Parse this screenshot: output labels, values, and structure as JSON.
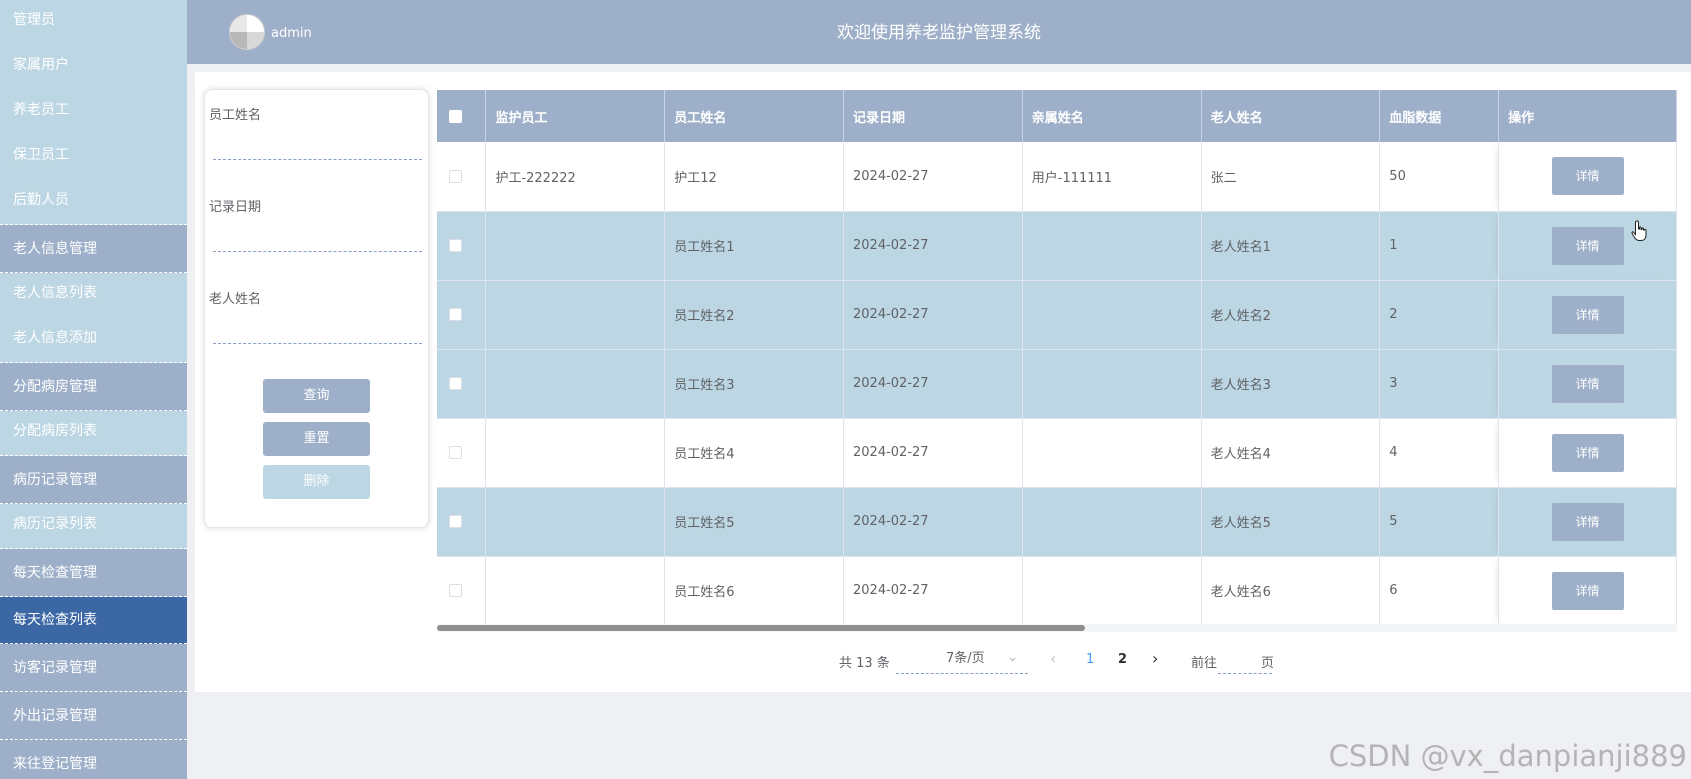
{
  "sidebar": {
    "items": [
      {
        "label": "管理员",
        "type": "sub"
      },
      {
        "label": "家属用户",
        "type": "sub"
      },
      {
        "label": "养老员工",
        "type": "sub"
      },
      {
        "label": "保卫员工",
        "type": "sub"
      },
      {
        "label": "后勤人员",
        "type": "sub"
      },
      {
        "label": "老人信息管理",
        "type": "group"
      },
      {
        "label": "老人信息列表",
        "type": "sub"
      },
      {
        "label": "老人信息添加",
        "type": "sub"
      },
      {
        "label": "分配病房管理",
        "type": "group"
      },
      {
        "label": "分配病房列表",
        "type": "sub"
      },
      {
        "label": "病历记录管理",
        "type": "group"
      },
      {
        "label": "病历记录列表",
        "type": "sub"
      },
      {
        "label": "每天检查管理",
        "type": "group"
      },
      {
        "label": "每天检查列表",
        "type": "active"
      },
      {
        "label": "访客记录管理",
        "type": "group"
      },
      {
        "label": "外出记录管理",
        "type": "group"
      },
      {
        "label": "来往登记管理",
        "type": "group"
      }
    ]
  },
  "header": {
    "user": "admin",
    "title": "欢迎使用养老监护管理系统"
  },
  "search": {
    "staff_name_label": "员工姓名",
    "record_date_label": "记录日期",
    "elder_name_label": "老人姓名",
    "query_button": "查询",
    "reset_button": "重置",
    "delete_button": "删除"
  },
  "table": {
    "columns": [
      "监护员工",
      "员工姓名",
      "记录日期",
      "亲属姓名",
      "老人姓名",
      "血脂数据",
      "操作"
    ],
    "rows": [
      {
        "guardian": "护工-222222",
        "staff": "护工12",
        "date": "2024-02-27",
        "relative": "用户-111111",
        "elder": "张二",
        "lipid": "50"
      },
      {
        "guardian": "",
        "staff": "员工姓名1",
        "date": "2024-02-27",
        "relative": "",
        "elder": "老人姓名1",
        "lipid": "1"
      },
      {
        "guardian": "",
        "staff": "员工姓名2",
        "date": "2024-02-27",
        "relative": "",
        "elder": "老人姓名2",
        "lipid": "2"
      },
      {
        "guardian": "",
        "staff": "员工姓名3",
        "date": "2024-02-27",
        "relative": "",
        "elder": "老人姓名3",
        "lipid": "3"
      },
      {
        "guardian": "",
        "staff": "员工姓名4",
        "date": "2024-02-27",
        "relative": "",
        "elder": "老人姓名4",
        "lipid": "4"
      },
      {
        "guardian": "",
        "staff": "员工姓名5",
        "date": "2024-02-27",
        "relative": "",
        "elder": "老人姓名5",
        "lipid": "5"
      },
      {
        "guardian": "",
        "staff": "员工姓名6",
        "date": "2024-02-27",
        "relative": "",
        "elder": "老人姓名6",
        "lipid": "6"
      }
    ],
    "detail_button": "详情"
  },
  "pagination": {
    "total": "共 13 条",
    "page_size": "7条/页",
    "prev": "‹",
    "page1": "1",
    "page2": "2",
    "next": "›",
    "goto": "前往",
    "page_suffix": "页"
  },
  "watermark": "CSDN @vx_danpianji889"
}
